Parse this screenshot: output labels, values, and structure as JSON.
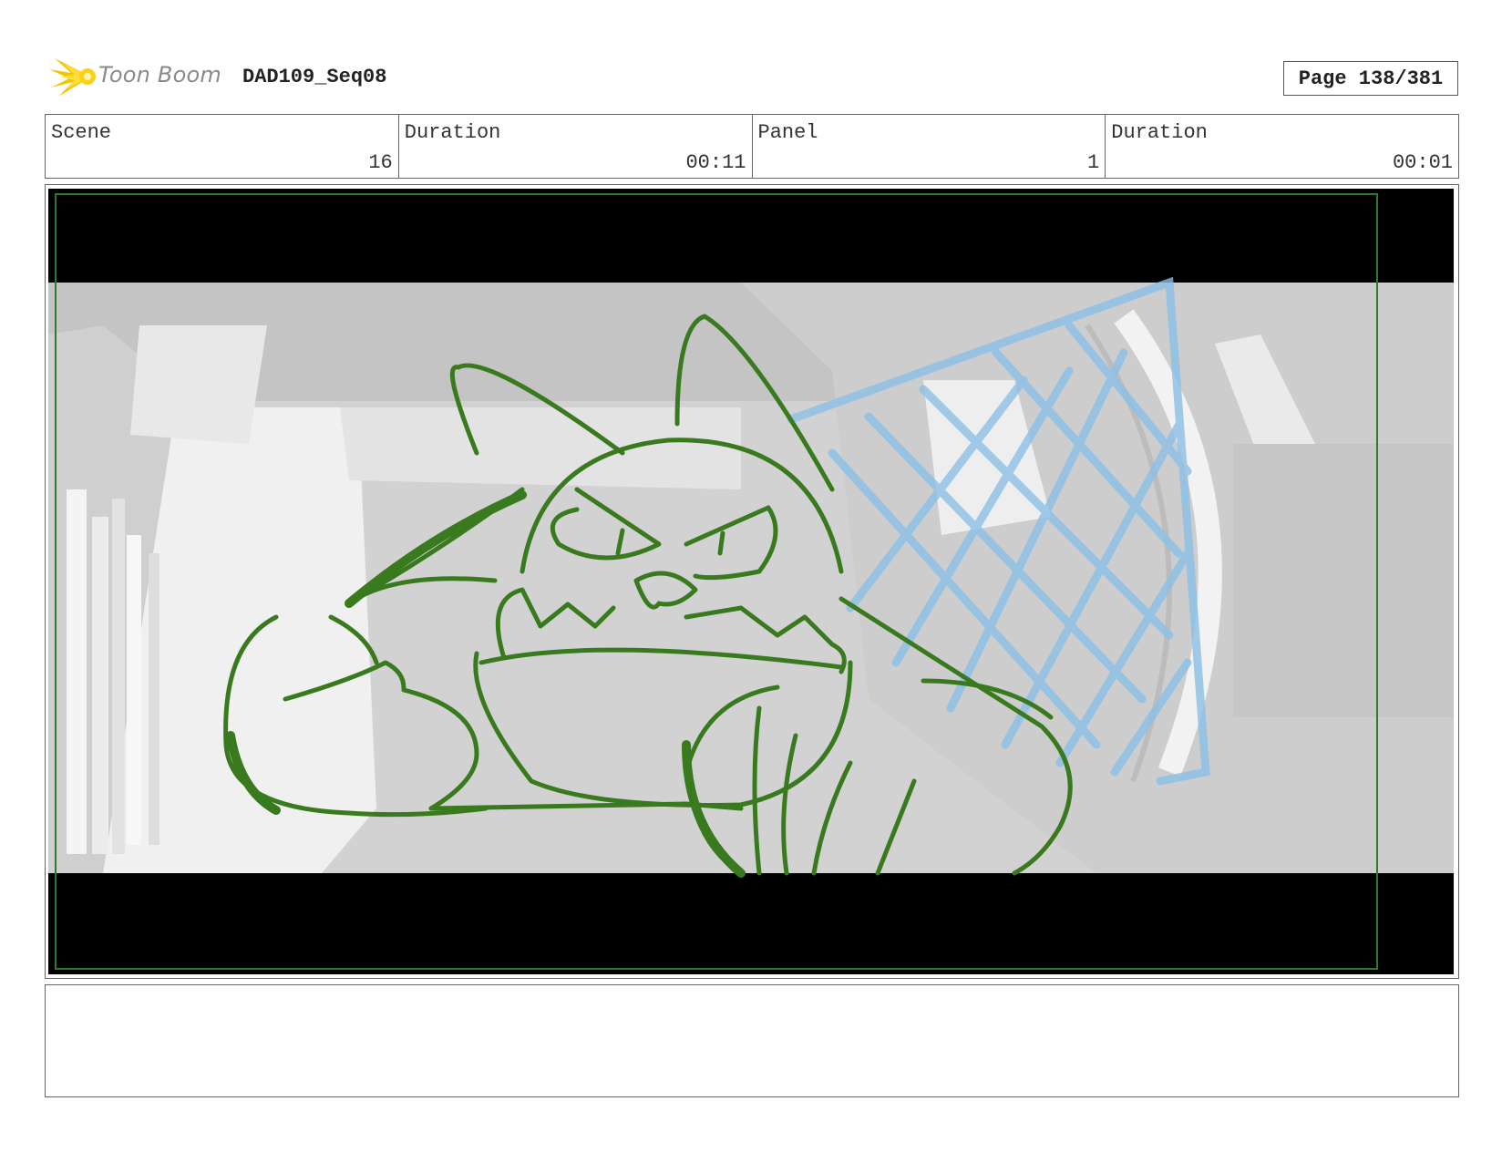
{
  "header": {
    "logo_text": "Toon Boom",
    "sequence": "DAD109_Seq08",
    "page": "Page 138/381"
  },
  "info": {
    "scene_label": "Scene",
    "scene_value": "16",
    "scene_duration_label": "Duration",
    "scene_duration_value": "00:11",
    "panel_label": "Panel",
    "panel_value": "1",
    "panel_duration_label": "Duration",
    "panel_duration_value": "00:01"
  },
  "panel_image": {
    "icon": "storyboard-drawing",
    "sketch_color": "#3a7a1f",
    "net_color": "#8cc0e6",
    "letterbox_color": "#000000"
  },
  "notes": {
    "text": ""
  }
}
